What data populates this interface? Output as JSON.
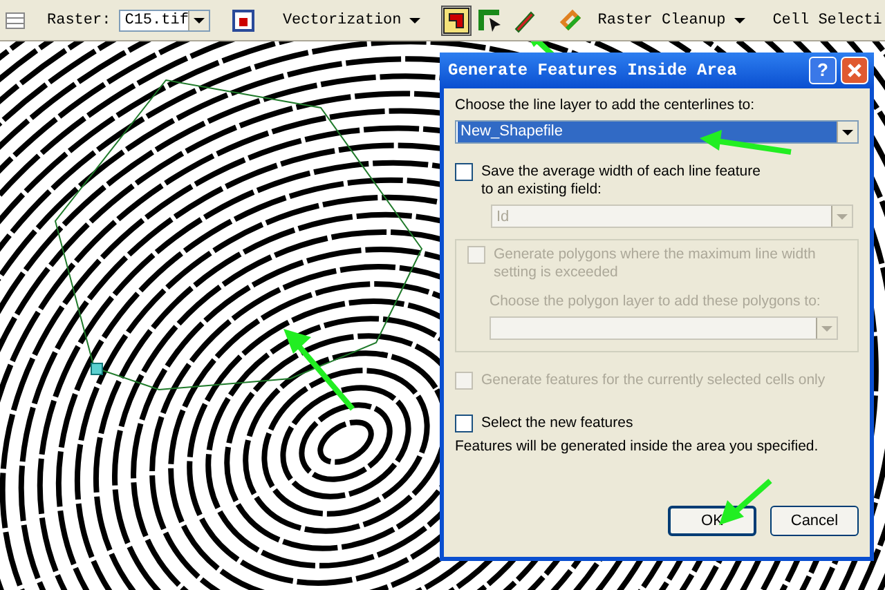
{
  "toolbar": {
    "raster_label": "Raster:",
    "raster_value": "C15.tif",
    "menus": [
      "Vectorization",
      "Raster Cleanup",
      "Cell Selecti"
    ]
  },
  "dialog": {
    "title": "Generate Features Inside Area",
    "help": "?",
    "layer_label": "Choose the line layer to add the centerlines to:",
    "layer_value": "New_Shapefile",
    "save_width": {
      "label": "Save the average width of each line feature to an existing field:",
      "checked": false,
      "disabled": false
    },
    "field_value": "Id",
    "field_disabled": true,
    "polygons": {
      "label": "Generate polygons where the maximum line width setting is exceeded",
      "checked": false,
      "disabled": true,
      "layer_label": "Choose the polygon layer to add these polygons to:"
    },
    "selected_cells": {
      "label": "Generate features for the currently selected cells only",
      "checked": false,
      "disabled": true
    },
    "select_new": {
      "label": "Select the new features",
      "checked": false,
      "disabled": false
    },
    "note": "Features will be generated inside the area you specified.",
    "buttons": [
      "OK",
      "Cancel"
    ]
  }
}
